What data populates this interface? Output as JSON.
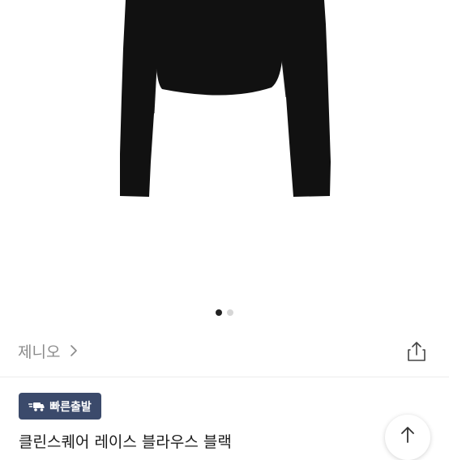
{
  "gallery": {
    "image_alt": "black long-sleeve lace blouse",
    "slide_count": 2,
    "active_slide": 0
  },
  "seller": {
    "name": "제니오",
    "chevron_icon": "chevron-right-icon",
    "share_icon": "share-icon"
  },
  "badge": {
    "label": "빠른출발",
    "icon": "fast-delivery-icon",
    "color": "#3b4a6b"
  },
  "product": {
    "title": "클린스퀘어 레이스 블라우스 블랙"
  },
  "scroll_top": {
    "icon": "arrow-up-icon"
  }
}
